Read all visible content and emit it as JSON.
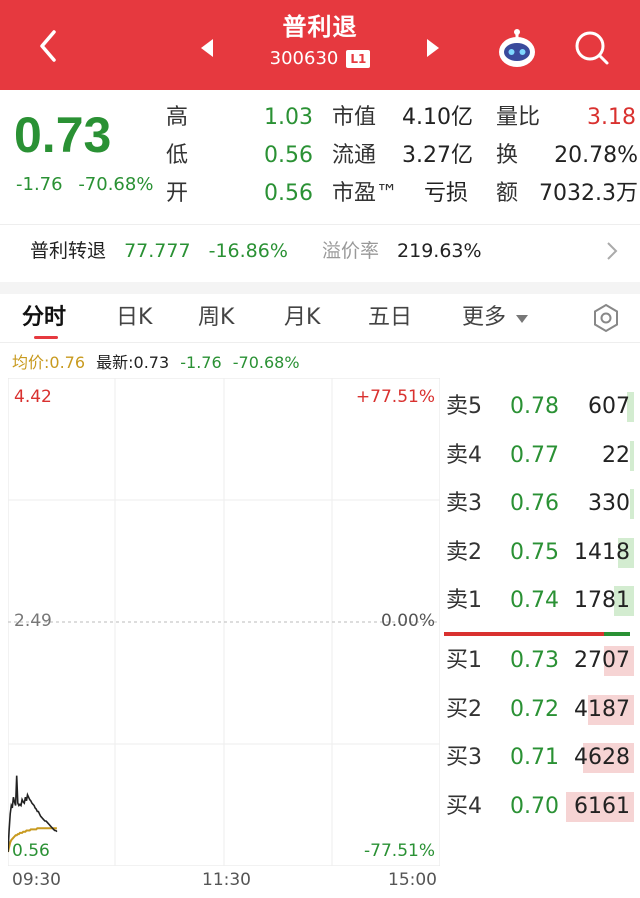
{
  "header": {
    "stock_name": "普利退",
    "stock_code": "300630",
    "level_badge": "L1"
  },
  "quote": {
    "price": "0.73",
    "change": "-1.76",
    "change_pct": "-70.68%",
    "stats": {
      "high_label": "高",
      "high": "1.03",
      "low_label": "低",
      "low": "0.56",
      "open_label": "开",
      "open": "0.56",
      "mcap_label": "市值",
      "mcap": "4.10亿",
      "float_label": "流通",
      "float": "3.27亿",
      "pe_label": "市盈™",
      "pe": "亏损",
      "vol_ratio_label": "量比",
      "vol_ratio": "3.18",
      "turnover_label": "换",
      "turnover": "20.78%",
      "amount_label": "额",
      "amount": "7032.3万"
    }
  },
  "convertible": {
    "name": "普利转退",
    "price": "77.777",
    "change_pct": "-16.86%",
    "premium_label": "溢价率",
    "premium": "219.63%"
  },
  "tabs": [
    "分时",
    "日K",
    "周K",
    "月K",
    "五日",
    "更多"
  ],
  "legend": {
    "avg": "均价:0.76",
    "latest": "最新:0.73",
    "change": "-1.76",
    "change_pct": "-70.68%"
  },
  "chart_data": {
    "type": "line",
    "y_labels": {
      "top": "4.42",
      "mid": "2.49",
      "bottom": "0.56"
    },
    "pct_labels": {
      "top": "+77.51%",
      "mid": "0.00%",
      "bottom": "-77.51%"
    },
    "x_labels": [
      "09:30",
      "11:30",
      "15:00"
    ],
    "ylim": [
      0.56,
      4.42
    ],
    "prev_close": 2.49,
    "series": [
      {
        "values": [
          0.56,
          0.74,
          0.88,
          0.95,
          0.93,
          1.02,
          0.98,
          0.95,
          1.2,
          0.97,
          0.95,
          0.96,
          0.95,
          1.0,
          0.98,
          0.97,
          1.02,
          0.99,
          1.04,
          1.02,
          1.0,
          0.99,
          0.97,
          0.96,
          0.95,
          0.93,
          0.92,
          0.9,
          0.9,
          0.88,
          0.86,
          0.85,
          0.84,
          0.83,
          0.82,
          0.82,
          0.81,
          0.8,
          0.79,
          0.78,
          0.77,
          0.76,
          0.75,
          0.74,
          0.74,
          0.73
        ]
      },
      {
        "values": [
          0.56,
          0.6,
          0.64,
          0.66,
          0.67,
          0.68,
          0.69,
          0.7,
          0.7,
          0.71,
          0.71,
          0.72,
          0.72,
          0.72,
          0.73,
          0.73,
          0.73,
          0.74,
          0.74,
          0.74,
          0.74,
          0.75,
          0.75,
          0.75,
          0.75,
          0.75,
          0.75,
          0.76,
          0.76,
          0.76,
          0.76,
          0.76,
          0.76,
          0.76,
          0.76,
          0.76,
          0.76,
          0.76,
          0.76,
          0.76,
          0.76,
          0.76,
          0.76,
          0.76,
          0.76,
          0.76
        ]
      }
    ],
    "points_per_session": 240,
    "colors": {
      "price_line": "#222222",
      "avg_line": "#c89a1f",
      "prev_close_line": "#bbbbbb"
    }
  },
  "order_book": {
    "sell": [
      {
        "label": "卖5",
        "price": "0.78",
        "volume": "607",
        "volume_num": 607
      },
      {
        "label": "卖4",
        "price": "0.77",
        "volume": "22",
        "volume_num": 22
      },
      {
        "label": "卖3",
        "price": "0.76",
        "volume": "330",
        "volume_num": 330
      },
      {
        "label": "卖2",
        "price": "0.75",
        "volume": "1418",
        "volume_num": 1418
      },
      {
        "label": "卖1",
        "price": "0.74",
        "volume": "1781",
        "volume_num": 1781
      }
    ],
    "buy": [
      {
        "label": "买1",
        "price": "0.73",
        "volume": "2707",
        "volume_num": 2707
      },
      {
        "label": "买2",
        "price": "0.72",
        "volume": "4187",
        "volume_num": 4187
      },
      {
        "label": "买3",
        "price": "0.71",
        "volume": "4628",
        "volume_num": 4628
      },
      {
        "label": "买4",
        "price": "0.70",
        "volume": "6161",
        "volume_num": 6161
      }
    ],
    "buy_sell_ratio": 0.86
  },
  "colors": {
    "header_bg": "#e6393f",
    "up": "#d9312f",
    "down": "#2a9134"
  }
}
